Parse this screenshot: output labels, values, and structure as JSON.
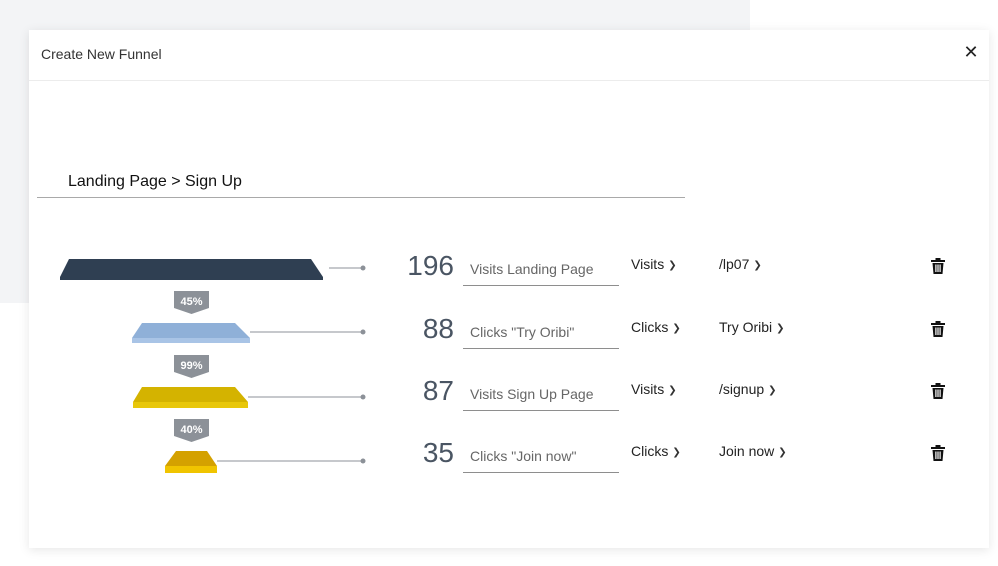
{
  "modal": {
    "title": "Create New Funnel",
    "close_label": "✕",
    "funnel_name": "Landing Page > Sign Up"
  },
  "colors": {
    "step_1": "#2f3f52",
    "step_2": "#8fb0d8",
    "step_3": "#d4b300",
    "step_4": "#d4a100",
    "badge": "#8c9198",
    "connector": "#8c9198"
  },
  "funnel": {
    "steps": [
      {
        "count": "196",
        "label": "Visits Landing Page",
        "metric": "Visits",
        "target": "/lp07"
      },
      {
        "count": "88",
        "label": "Clicks \"Try Oribi\"",
        "metric": "Clicks",
        "target": "Try Oribi"
      },
      {
        "count": "87",
        "label": "Visits Sign Up Page",
        "metric": "Visits",
        "target": "/signup"
      },
      {
        "count": "35",
        "label": "Clicks \"Join now\"",
        "metric": "Clicks",
        "target": "Join now"
      }
    ],
    "conversions": [
      "45%",
      "99%",
      "40%"
    ]
  },
  "icons": {
    "close": "close-icon",
    "dropdown": "chevron-down-icon",
    "delete": "trash-icon"
  }
}
